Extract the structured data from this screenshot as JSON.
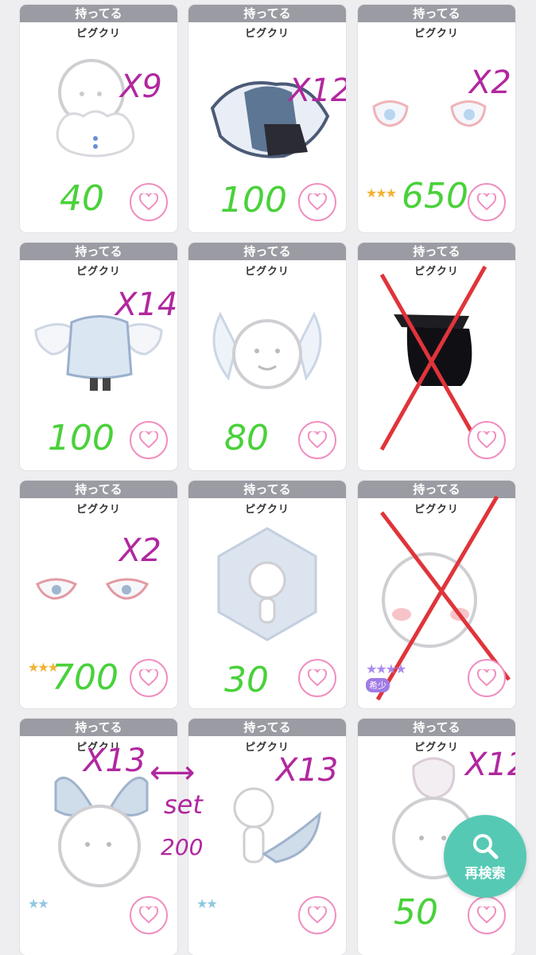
{
  "cards": [
    {
      "status": "持ってる",
      "name": "ピグクリ",
      "price": "40",
      "count": "X9"
    },
    {
      "status": "持ってる",
      "name": "ピグクリ",
      "price": "100",
      "count": "X12"
    },
    {
      "status": "持ってる",
      "name": "ピグクリ",
      "price": "650",
      "count": "X2",
      "stars": "★★★",
      "star_color": "#f2b233"
    },
    {
      "status": "持ってる",
      "name": "ピグクリ",
      "price": "100",
      "count": "X14"
    },
    {
      "status": "持ってる",
      "name": "ピグクリ",
      "price": "80",
      "count": ""
    },
    {
      "status": "持ってる",
      "name": "ピグクリ",
      "price": "",
      "count": "",
      "crossed": true
    },
    {
      "status": "持ってる",
      "name": "ピグクリ",
      "price": "700",
      "count": "X2",
      "stars": "★★★",
      "star_color": "#f2b233"
    },
    {
      "status": "持ってる",
      "name": "ピグクリ",
      "price": "30",
      "count": ""
    },
    {
      "status": "持ってる",
      "name": "ピグクリ",
      "price": "",
      "count": "",
      "crossed": true,
      "stars": "★★★★",
      "star_color": "#a78bf0",
      "badge": "希少"
    },
    {
      "status": "持ってる",
      "name": "ピグクリ",
      "price": "",
      "count": "X13",
      "stars": "★★",
      "star_color": "#8fc7e0"
    },
    {
      "status": "持ってる",
      "name": "ピグクリ",
      "price": "",
      "count": "X13",
      "stars": "★★",
      "star_color": "#8fc7e0"
    },
    {
      "status": "持ってる",
      "name": "ピグクリ",
      "price": "50",
      "count": "X12"
    }
  ],
  "set_note": {
    "label": "set",
    "price": "200",
    "arrow": "⟷"
  },
  "research_button": {
    "label": "再検索",
    "icon": "search-icon"
  },
  "colors": {
    "price_ink": "#49d13a",
    "count_ink": "#b1279f",
    "cross_ink": "#e0343a",
    "heart": "#f08fc0",
    "accent": "#56c9b4"
  }
}
